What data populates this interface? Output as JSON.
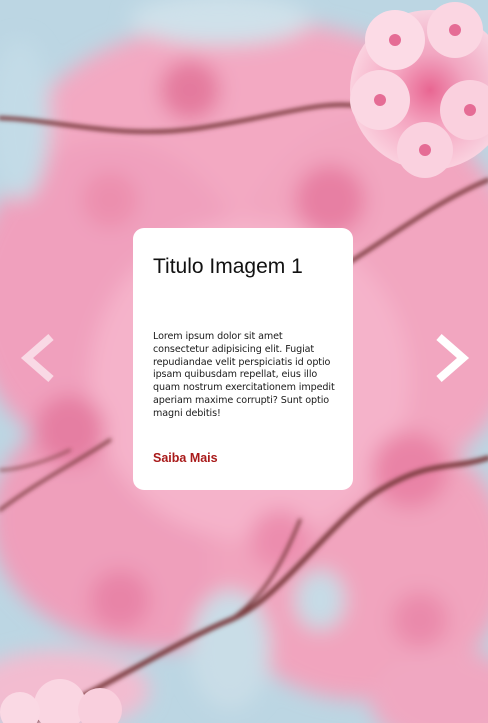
{
  "slide": {
    "title": "Titulo Imagem 1",
    "description": "Lorem ipsum dolor sit amet consectetur adipisicing elit. Fugiat repudiandae velit perspiciatis id optio ipsam quibusdam repellat, eius illo quam nostrum exercitationem impedit aperiam maxime corrupti? Sunt optio magni debitis!",
    "link_label": "Saiba Mais"
  },
  "navigation": {
    "prev_icon": "chevron-left-icon",
    "next_icon": "chevron-right-icon"
  },
  "colors": {
    "link": "#a91a1a",
    "card_background": "#ffffff",
    "blossom_pink": "#f2a7c0",
    "sky_blue": "#c8dbe6",
    "branch": "#7a3a3e"
  }
}
